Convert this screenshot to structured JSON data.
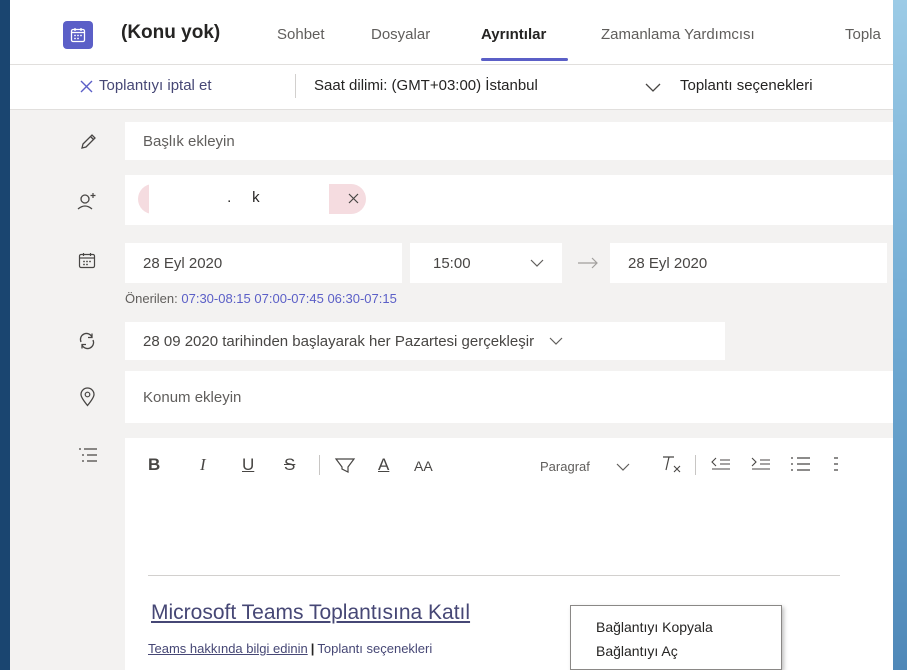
{
  "header": {
    "title": "(Konu yok)",
    "tabs": [
      "Sohbet",
      "Dosyalar",
      "Ayrıntılar",
      "Zamanlama Yardımcısı",
      "Topla"
    ],
    "active_tab": "Ayrıntılar"
  },
  "toolbar": {
    "cancel_label": "Toplantıyı iptal et",
    "timezone_label": "Saat dilimi: (GMT+03:00) İstanbul",
    "options_label": "Toplantı seçenekleri"
  },
  "form": {
    "title_placeholder": "Başlık ekleyin",
    "attendee_chip_text": " .     k",
    "start_date": "28 Eyl 2020",
    "start_time": "15:00",
    "end_date": "28 Eyl 2020",
    "suggested_label": "Önerilen:",
    "suggested_slots": [
      "07:30-08:15",
      "07:00-07:45",
      "06:30-07:15"
    ],
    "recurrence": "28 09 2020 tarihinden başlayarak her Pazartesi gerçekleşir",
    "location_placeholder": "Konum ekleyin"
  },
  "editor": {
    "bold": "B",
    "italic": "I",
    "underline": "U",
    "strike": "S",
    "font_color": "A",
    "font_size": "AA",
    "paragraph_label": "Paragraf",
    "join_link": "Microsoft Teams Toplantısına Katıl",
    "learn_more": "Teams hakkında bilgi edinin",
    "separator": "|",
    "meeting_options": "Toplantı seçenekleri"
  },
  "context_menu": {
    "copy_link": "Bağlantıyı Kopyala",
    "open_link": "Bağlantıyı Aç"
  },
  "colors": {
    "accent": "#5b5fc7",
    "link": "#464775"
  }
}
